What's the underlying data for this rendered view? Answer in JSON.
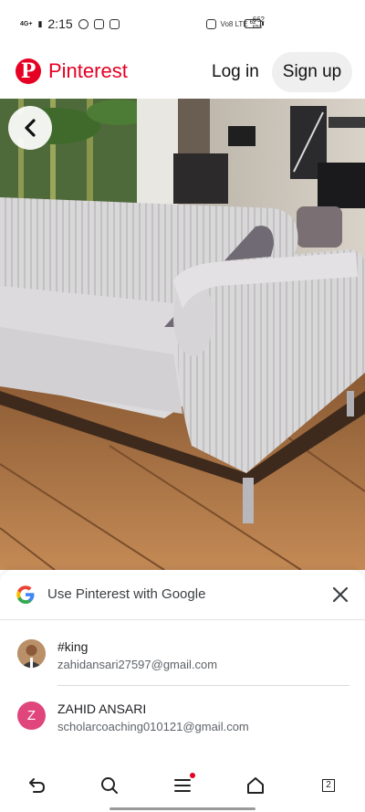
{
  "status_bar": {
    "signal_label": "4G+",
    "time": "2:15",
    "network_label": "Vo8 LTE",
    "speed_value": "662",
    "speed_unit": "KB/s",
    "battery_level": "62"
  },
  "header": {
    "brand": "Pinterest",
    "login_label": "Log in",
    "signup_label": "Sign up",
    "brand_color": "#e60023"
  },
  "google_sheet": {
    "title": "Use Pinterest with Google",
    "accounts": [
      {
        "name": "#king",
        "email": "zahidansari27597@gmail.com",
        "avatar": "photo"
      },
      {
        "name": "ZAHID ANSARI",
        "email": "scholarcoaching010121@gmail.com",
        "avatar_letter": "Z",
        "avatar_color": "#e0457b"
      }
    ]
  },
  "nav": {
    "tabs_count": "2",
    "icons": [
      "back-icon",
      "search-icon",
      "menu-icon",
      "home-icon",
      "tabs-icon"
    ]
  }
}
